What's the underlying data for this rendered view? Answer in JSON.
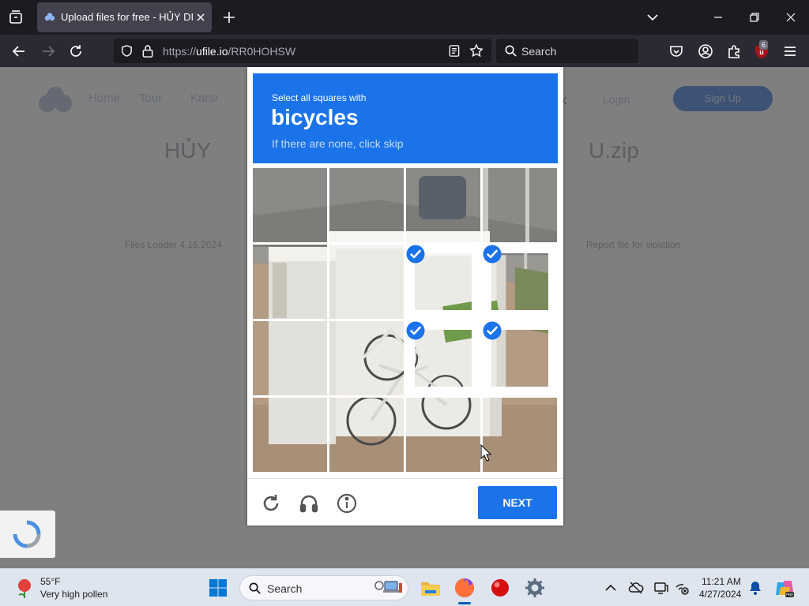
{
  "browser": {
    "tab": {
      "title": "Upload files for free - HỦY DIỆT"
    },
    "url": {
      "prefix": "https://",
      "host": "ufile.io",
      "path": "/RR0HOHSW"
    },
    "search_placeholder": "Search",
    "extension_badge": "6"
  },
  "page": {
    "nav": [
      "Home",
      "Tour",
      "Karsr"
    ],
    "login": "Login",
    "signup": "Sign Up",
    "heading_left": "HỦY",
    "heading_right": "U.zip",
    "meta_left": "Files Loader 4.16.2024",
    "meta_right": "Report file for violation"
  },
  "captcha": {
    "prompt": "Select all squares with",
    "object": "bicycles",
    "hint": "If there are none, click skip",
    "selected_tiles": [
      6,
      7,
      10,
      11
    ],
    "next_label": "NEXT",
    "accent_color": "#1a73e8"
  },
  "taskbar": {
    "weather_temp": "55°F",
    "weather_desc": "Very high pollen",
    "search_label": "Search",
    "time": "11:21 AM",
    "date": "4/27/2024"
  }
}
